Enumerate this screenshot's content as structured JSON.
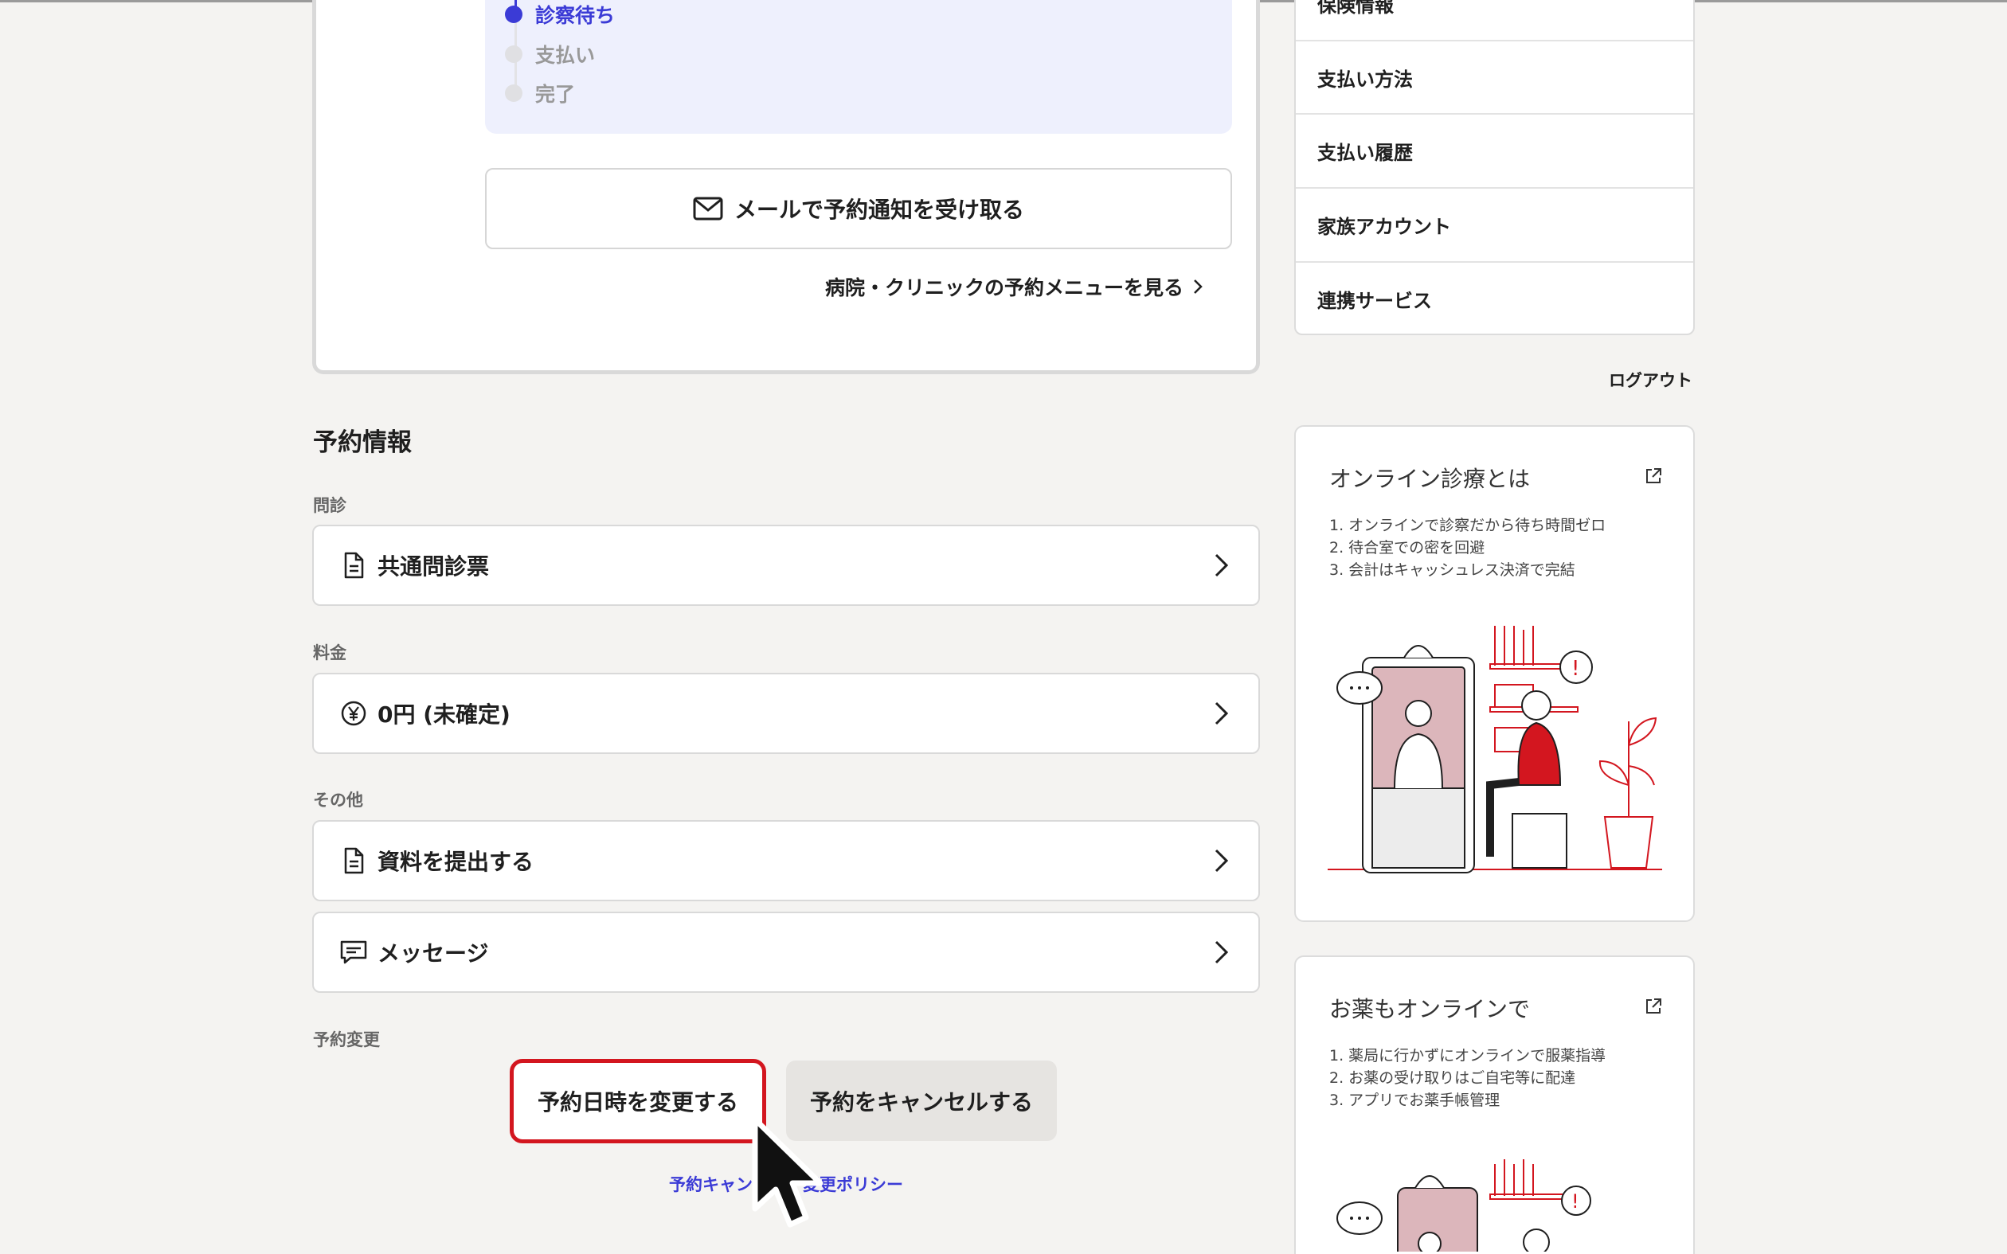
{
  "status": {
    "steps": [
      {
        "label": "診察待ち",
        "active": true
      },
      {
        "label": "支払い",
        "active": false
      },
      {
        "label": "完了",
        "active": false
      }
    ],
    "mail_button": "メールで予約通知を受け取る",
    "clinic_link": "病院・クリニックの予約メニューを見る"
  },
  "reservation": {
    "title": "予約情報",
    "questionnaire": {
      "label": "問診",
      "item": "共通問診票"
    },
    "fee": {
      "label": "料金",
      "item": "0円 (未確定)"
    },
    "other": {
      "label": "その他",
      "submit": "資料を提出する",
      "message": "メッセージ"
    },
    "change": {
      "label": "予約変更",
      "change_button": "予約日時を変更する",
      "cancel_button": "予約をキャンセルする",
      "policy_link": "予約キャンセル・変更ポリシー"
    }
  },
  "menu": {
    "items": [
      "保険情報",
      "支払い方法",
      "支払い履歴",
      "家族アカウント",
      "連携サービス"
    ],
    "logout": "ログアウト"
  },
  "info_cards": [
    {
      "title": "オンライン診療とは",
      "lines": [
        "1. オンラインで診察だから待ち時間ゼロ",
        "2. 待合室での密を回避",
        "3. 会計はキャッシュレス決済で完結"
      ]
    },
    {
      "title": "お薬もオンラインで",
      "lines": [
        "1. 薬局に行かずにオンラインで服薬指導",
        "2. お薬の受け取りはご自宅等に配達",
        "3. アプリでお薬手帳管理"
      ]
    }
  ],
  "colors": {
    "accent": "#3b3bd6",
    "highlight": "#d3161f",
    "background": "#f4f3f1"
  }
}
